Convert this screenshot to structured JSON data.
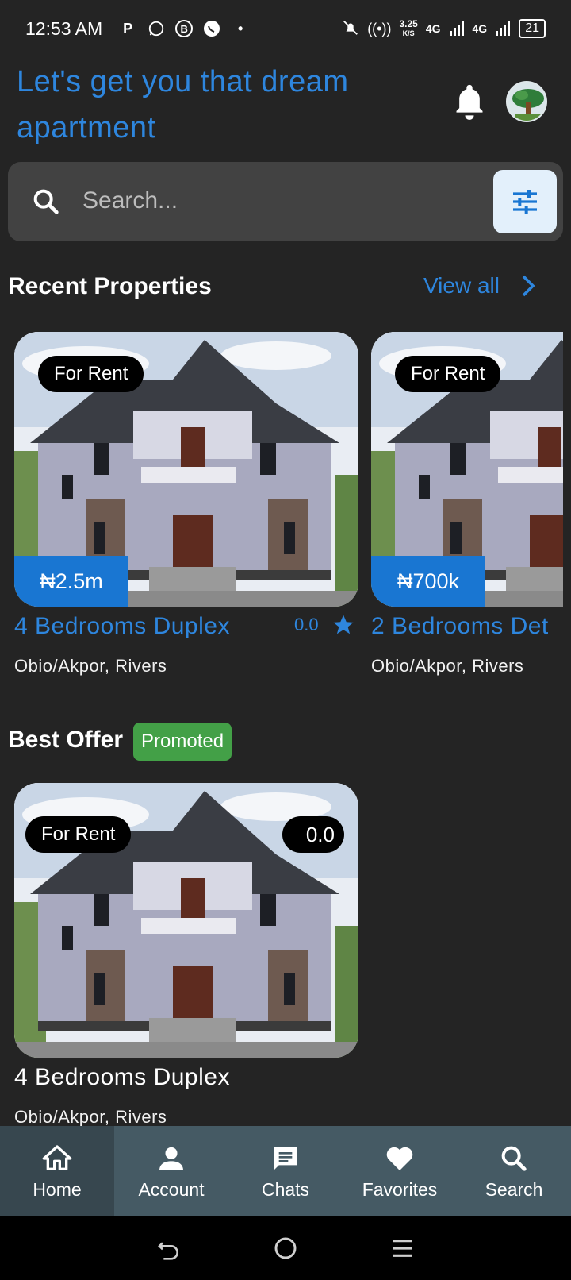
{
  "status_bar": {
    "time": "12:53 AM",
    "notif_icons": [
      "P",
      "whatsapp-icon",
      "B",
      "whatsapp-icon",
      "•"
    ],
    "speed": "3.25",
    "speed_unit": "K/S",
    "net1": "4G",
    "net2": "4G",
    "battery": "21"
  },
  "header": {
    "title": "Let's get you that dream apartment"
  },
  "search": {
    "placeholder": "Search..."
  },
  "recent": {
    "title": "Recent Properties",
    "view_all": "View all",
    "cards": [
      {
        "tag": "For Rent",
        "price": "₦2.5m",
        "title": "4 Bedrooms Duplex",
        "rating": "0.0",
        "location": "Obio/Akpor, Rivers"
      },
      {
        "tag": "For Rent",
        "price": "₦700k",
        "title": "2 Bedrooms Det",
        "location": "Obio/Akpor, Rivers"
      }
    ]
  },
  "best_offer": {
    "title": "Best Offer",
    "badge": "Promoted",
    "card": {
      "tag": "For Rent",
      "rating": "0.0",
      "title": "4 Bedrooms Duplex",
      "location": "Obio/Akpor, Rivers"
    }
  },
  "bottom_nav": {
    "items": [
      {
        "label": "Home",
        "icon": "home-icon"
      },
      {
        "label": "Account",
        "icon": "person-icon"
      },
      {
        "label": "Chats",
        "icon": "chat-icon"
      },
      {
        "label": "Favorites",
        "icon": "heart-icon"
      },
      {
        "label": "Search",
        "icon": "search-icon"
      }
    ]
  },
  "colors": {
    "background": "#242424",
    "accent": "#2e86de",
    "price_badge": "#1976d2",
    "promoted": "#43a047",
    "nav": "#455a64"
  }
}
